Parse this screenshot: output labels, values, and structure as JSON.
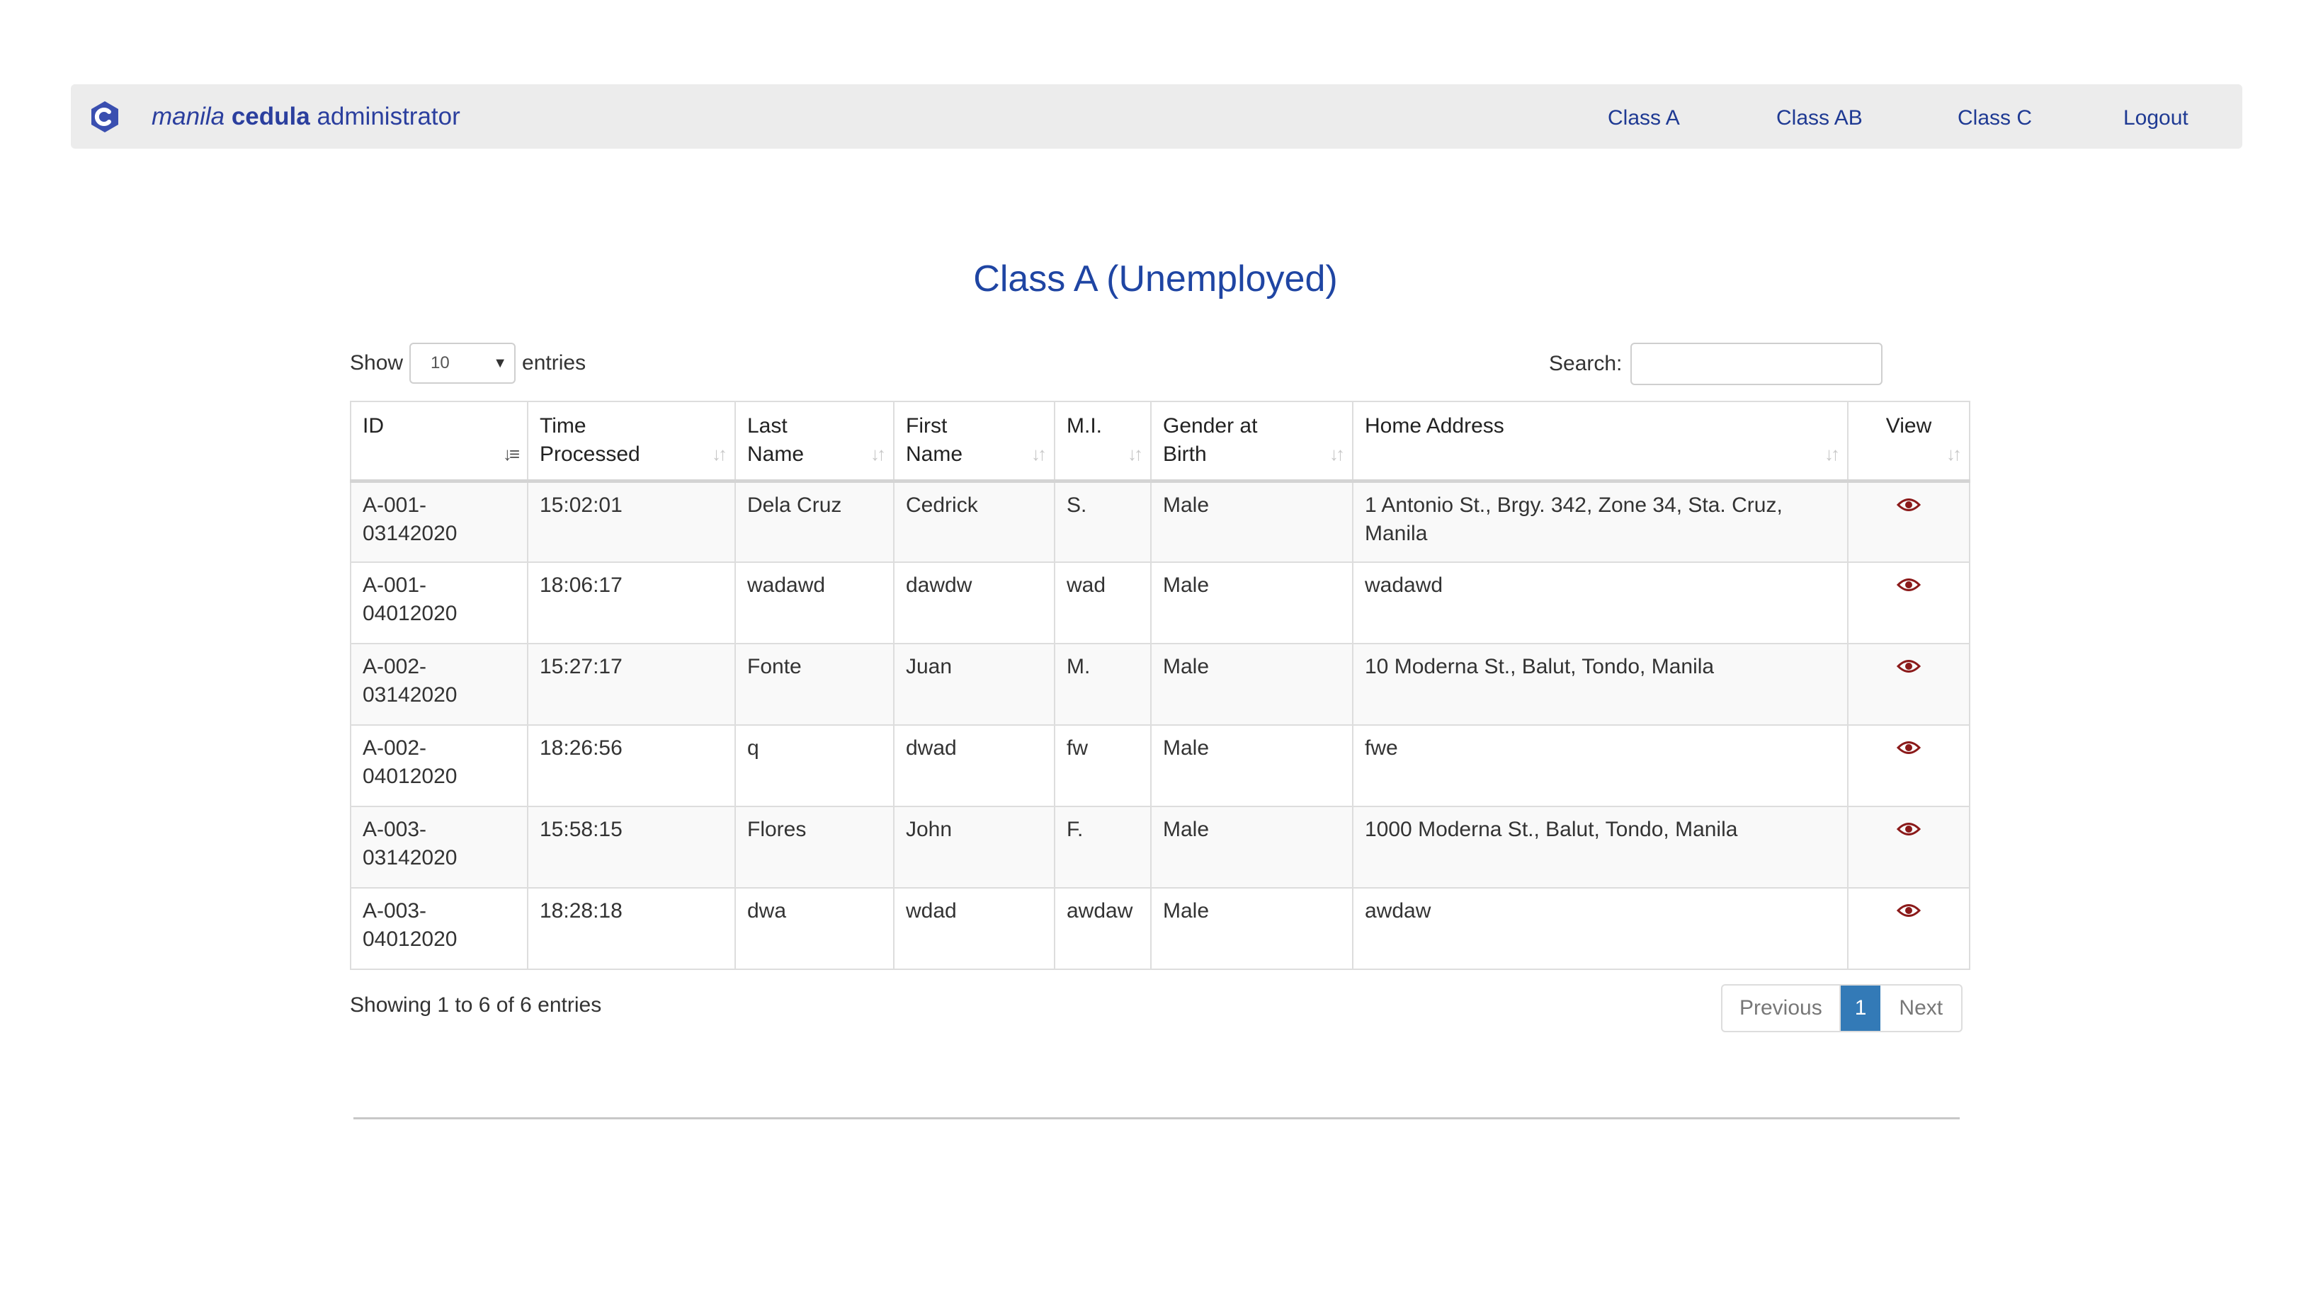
{
  "brand": {
    "part1": "manila",
    "part2": "cedula",
    "part3": "administrator",
    "logo_icon": "c-logo-icon"
  },
  "nav": {
    "class_a": "Class A",
    "class_ab": "Class AB",
    "class_c": "Class C",
    "logout": "Logout"
  },
  "page": {
    "title": "Class A (Unemployed)"
  },
  "length": {
    "show_label": "Show",
    "value": "10",
    "entries_label": "entries"
  },
  "search": {
    "label": "Search:",
    "value": ""
  },
  "table": {
    "headers": {
      "id": "ID",
      "time1": "Time",
      "time2": "Processed",
      "last1": "Last",
      "last2": "Name",
      "first1": "First",
      "first2": "Name",
      "mi": "M.I.",
      "gender1": "Gender at",
      "gender2": "Birth",
      "address": "Home Address",
      "view": "View"
    },
    "rows": [
      {
        "id1": "A-001-",
        "id2": "03142020",
        "time": "15:02:01",
        "last": "Dela Cruz",
        "first": "Cedrick",
        "mi": "S.",
        "gender": "Male",
        "address": "1 Antonio St., Brgy. 342, Zone 34, Sta. Cruz, Manila"
      },
      {
        "id1": "A-001-",
        "id2": "04012020",
        "time": "18:06:17",
        "last": "wadawd",
        "first": "dawdw",
        "mi": "wad",
        "gender": "Male",
        "address": "wadawd"
      },
      {
        "id1": "A-002-",
        "id2": "03142020",
        "time": "15:27:17",
        "last": "Fonte",
        "first": "Juan",
        "mi": "M.",
        "gender": "Male",
        "address": "10 Moderna St., Balut, Tondo, Manila"
      },
      {
        "id1": "A-002-",
        "id2": "04012020",
        "time": "18:26:56",
        "last": "q",
        "first": "dwad",
        "mi": "fw",
        "gender": "Male",
        "address": "fwe"
      },
      {
        "id1": "A-003-",
        "id2": "03142020",
        "time": "15:58:15",
        "last": "Flores",
        "first": "John",
        "mi": "F.",
        "gender": "Male",
        "address": "1000 Moderna St., Balut, Tondo, Manila"
      },
      {
        "id1": "A-003-",
        "id2": "04012020",
        "time": "18:28:18",
        "last": "dwa",
        "first": "wdad",
        "mi": "awdaw",
        "gender": "Male",
        "address": "awdaw"
      }
    ]
  },
  "info": {
    "text": "Showing 1 to 6 of 6 entries"
  },
  "pagination": {
    "previous": "Previous",
    "current": "1",
    "next": "Next"
  },
  "colors": {
    "brand": "#2b3f9e",
    "title": "#1f45a3",
    "pagination_active": "#337ab7",
    "eye": "#8b1a1a"
  }
}
